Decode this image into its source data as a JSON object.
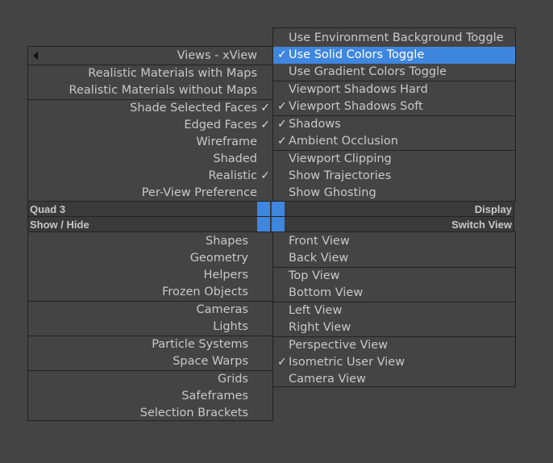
{
  "top_right_menu": {
    "items": [
      {
        "label": "Use Environment Background Toggle",
        "checked": false
      },
      {
        "label": "Use Solid Colors Toggle",
        "checked": true,
        "highlighted": true
      },
      {
        "label": "Use Gradient Colors Toggle",
        "checked": false
      },
      {
        "label": "Viewport Shadows Hard",
        "checked": false
      },
      {
        "label": "Viewport Shadows Soft",
        "checked": true
      },
      {
        "label": "Shadows",
        "checked": true
      },
      {
        "label": "Ambient Occlusion",
        "checked": true
      },
      {
        "label": "Viewport Clipping",
        "checked": false
      },
      {
        "label": "Show Trajectories",
        "checked": false
      },
      {
        "label": "Show Ghosting",
        "checked": false
      }
    ]
  },
  "top_left_menu": {
    "title": "Views - xView",
    "items": [
      {
        "label": "Realistic Materials with Maps",
        "checked": false
      },
      {
        "label": "Realistic Materials without Maps",
        "checked": false
      },
      {
        "label": "Shade Selected Faces",
        "checked": true
      },
      {
        "label": "Edged Faces",
        "checked": true
      },
      {
        "label": "Wireframe",
        "checked": false
      },
      {
        "label": "Shaded",
        "checked": false
      },
      {
        "label": "Realistic",
        "checked": true
      },
      {
        "label": "Per-View Preference",
        "checked": false
      }
    ]
  },
  "quad_bars": {
    "top": {
      "left": "Quad 3",
      "right": "Display"
    },
    "bottom": {
      "left": "Show / Hide",
      "right": "Switch View"
    }
  },
  "bottom_left_menu": {
    "items": [
      {
        "label": "Shapes"
      },
      {
        "label": "Geometry"
      },
      {
        "label": "Helpers"
      },
      {
        "label": "Frozen Objects"
      },
      {
        "label": "Cameras"
      },
      {
        "label": "Lights"
      },
      {
        "label": "Particle Systems"
      },
      {
        "label": "Space Warps"
      },
      {
        "label": "Grids"
      },
      {
        "label": "Safeframes"
      },
      {
        "label": "Selection Brackets"
      }
    ]
  },
  "bottom_right_menu": {
    "items": [
      {
        "label": "Front View",
        "checked": false
      },
      {
        "label": "Back View",
        "checked": false
      },
      {
        "label": "Top View",
        "checked": false
      },
      {
        "label": "Bottom View",
        "checked": false
      },
      {
        "label": "Left View",
        "checked": false
      },
      {
        "label": "Right View",
        "checked": false
      },
      {
        "label": "Perspective View",
        "checked": false
      },
      {
        "label": "Isometric User View",
        "checked": true
      },
      {
        "label": "Camera View",
        "checked": false
      }
    ]
  },
  "check_glyph": "✓",
  "colors": {
    "highlight": "#3f86de",
    "background": "#444444",
    "border": "#222222",
    "text": "#c8c8c8"
  }
}
